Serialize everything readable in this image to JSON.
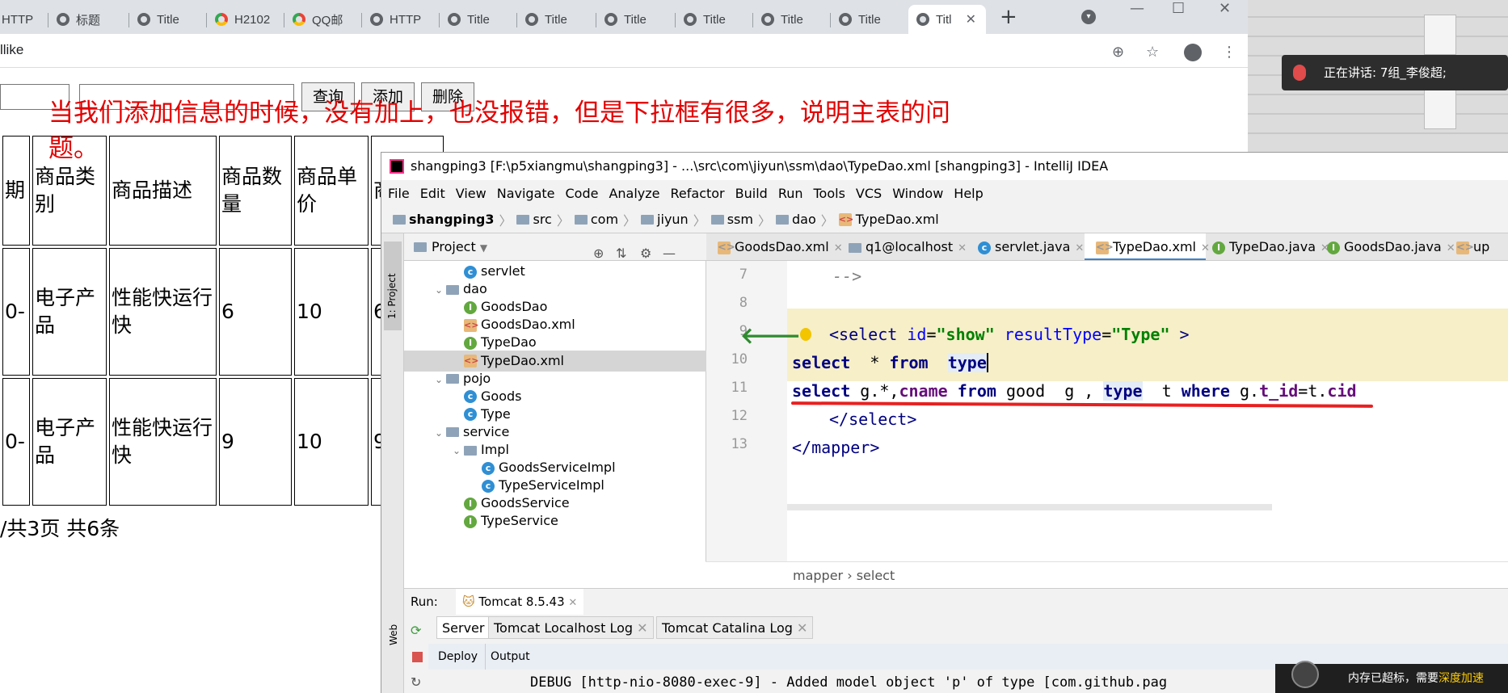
{
  "browser": {
    "tabs": [
      "HTTP",
      "标题",
      "Title",
      "H2102",
      "QQ邮",
      "HTTP",
      "Title",
      "Title",
      "Title",
      "Title",
      "Title",
      "Title",
      "Titl"
    ],
    "new_tab": "+",
    "address": "llike"
  },
  "page": {
    "buttons": {
      "query": "查询",
      "add": "添加",
      "delete": "删除"
    },
    "annotation": "当我们添加信息的时候，没有加上，也没报错，但是下拉框有很多，说明主表的问题。",
    "table": {
      "headers": [
        "期",
        "商品类别",
        "商品描述",
        "商品数量",
        "商品单价",
        "商"
      ],
      "rows": [
        [
          "0-",
          "电子产品",
          "性能快运行快",
          "6",
          "10",
          "6"
        ],
        [
          "0-",
          "电子产品",
          "性能快运行快",
          "9",
          "10",
          "9"
        ]
      ]
    },
    "pager": "/共3页 共6条"
  },
  "overlay": {
    "speaking": "正在讲话: 7组_李俊超;",
    "memory_warning": "内存已超标，需要",
    "memory_action": "深度加速"
  },
  "ide": {
    "title": "shangping3 [F:\\p5xiangmu\\shangping3] - ...\\src\\com\\jiyun\\ssm\\dao\\TypeDao.xml [shangping3] - IntelliJ IDEA",
    "menu": [
      "File",
      "Edit",
      "View",
      "Navigate",
      "Code",
      "Analyze",
      "Refactor",
      "Build",
      "Run",
      "Tools",
      "VCS",
      "Window",
      "Help"
    ],
    "breadcrumbs": [
      "shangping3",
      "src",
      "com",
      "jiyun",
      "ssm",
      "dao",
      "TypeDao.xml"
    ],
    "left_strip": {
      "project": "1: Project",
      "web": "Web"
    },
    "project_header": "Project",
    "tree": [
      {
        "label": "servlet",
        "icon": "class",
        "indent": 3
      },
      {
        "label": "dao",
        "icon": "folder",
        "indent": 2,
        "open": true
      },
      {
        "label": "GoodsDao",
        "icon": "interface",
        "indent": 3
      },
      {
        "label": "GoodsDao.xml",
        "icon": "xml",
        "indent": 3
      },
      {
        "label": "TypeDao",
        "icon": "interface",
        "indent": 3
      },
      {
        "label": "TypeDao.xml",
        "icon": "xml",
        "indent": 3,
        "selected": true
      },
      {
        "label": "pojo",
        "icon": "folder",
        "indent": 2,
        "open": true
      },
      {
        "label": "Goods",
        "icon": "class",
        "indent": 3
      },
      {
        "label": "Type",
        "icon": "class",
        "indent": 3
      },
      {
        "label": "service",
        "icon": "folder",
        "indent": 2,
        "open": true
      },
      {
        "label": "Impl",
        "icon": "folder",
        "indent": 3,
        "open": true
      },
      {
        "label": "GoodsServiceImpl",
        "icon": "class",
        "indent": 4
      },
      {
        "label": "TypeServiceImpl",
        "icon": "class",
        "indent": 4
      },
      {
        "label": "GoodsService",
        "icon": "interface",
        "indent": 3
      },
      {
        "label": "TypeService",
        "icon": "interface",
        "indent": 3
      }
    ],
    "editor_tabs": [
      "GoodsDao.xml",
      "q1@localhost",
      "servlet.java",
      "TypeDao.xml",
      "TypeDao.java",
      "GoodsDao.java",
      "up"
    ],
    "line_numbers": [
      "7",
      "8",
      "9",
      "10",
      "11",
      "12",
      "13"
    ],
    "code": {
      "l7": "-->",
      "l9_tag": "select",
      "l9_attr1": "id",
      "l9_val1": "\"show\"",
      "l9_attr2": "resultType",
      "l9_val2": "\"Type\"",
      "l10_select": "select",
      "l10_star": "* ",
      "l10_from": "from",
      "l10_type": "type",
      "l11_select": "select",
      "l11_g": "g.*,",
      "l11_cname": "cname",
      "l11_from": "from",
      "l11_good": "good",
      "l11_galias": "g ,",
      "l11_type": "type",
      "l11_t": "t",
      "l11_where": "where",
      "l11_g2": "g.",
      "l11_tid": "t_id",
      "l11_eq": "=t.",
      "l11_cid": "cid",
      "l12": "</select>",
      "l13": "</mapper>"
    },
    "editor_breadcrumbs": [
      "mapper",
      "select"
    ],
    "run": {
      "label": "Run:",
      "config": "Tomcat 8.5.43",
      "tabs": [
        "Server",
        "Tomcat Localhost Log",
        "Tomcat Catalina Log"
      ],
      "columns": [
        "Deploy",
        "Output"
      ],
      "log_line": "DEBUG [http-nio-8080-exec-9] - Added model object 'p' of type [com.github.pag"
    }
  },
  "colors": {
    "annotation": "#e30000",
    "underline": "#e82020",
    "highlight_line": "#f6efc8"
  }
}
